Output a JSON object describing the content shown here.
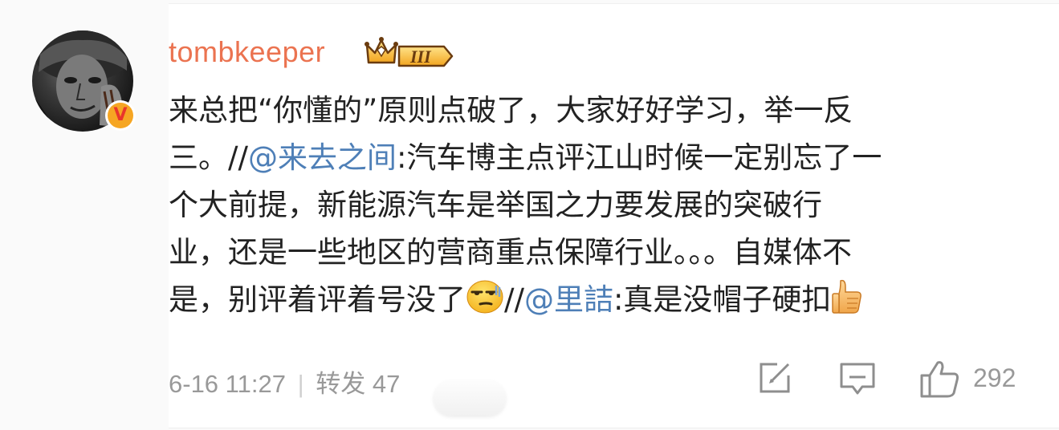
{
  "post": {
    "username": "tombkeeper",
    "vip_level": "III",
    "lines": {
      "l1": "来总把“你懂的”原则点破了，大家好好学习，举一反",
      "l2_pre": "三。//",
      "l2_mention": "@来去之间",
      "l2_post": ":汽车博主点评江山时候一定别忘了一",
      "l3": "个大前提，新能源汽车是举国之力要发展的突破行",
      "l4": "业，还是一些地区的营商重点保障行业。。。自媒体不",
      "l5_pre": "是，别评着评着号没了",
      "l5_mid": "//",
      "l5_mention": "@里詰",
      "l5_post": ":真是没帽子硬扣"
    },
    "timestamp": "6-16 11:27",
    "separator": "|",
    "repost_label": "转发",
    "repost_count": "47",
    "like_count": "292"
  },
  "icons": {
    "avatar": "avatar-image",
    "verified": "verified-badge-icon",
    "vip": "vip-crown-icon",
    "smirk": "smirk-emoji-icon",
    "thumb": "thumbs-up-emoji-icon",
    "edit": "edit-icon",
    "comment": "comment-icon",
    "like": "like-icon"
  },
  "colors": {
    "username": "#eb7350",
    "mention": "#4e7fb7",
    "meta": "#999999",
    "text": "#222222"
  }
}
